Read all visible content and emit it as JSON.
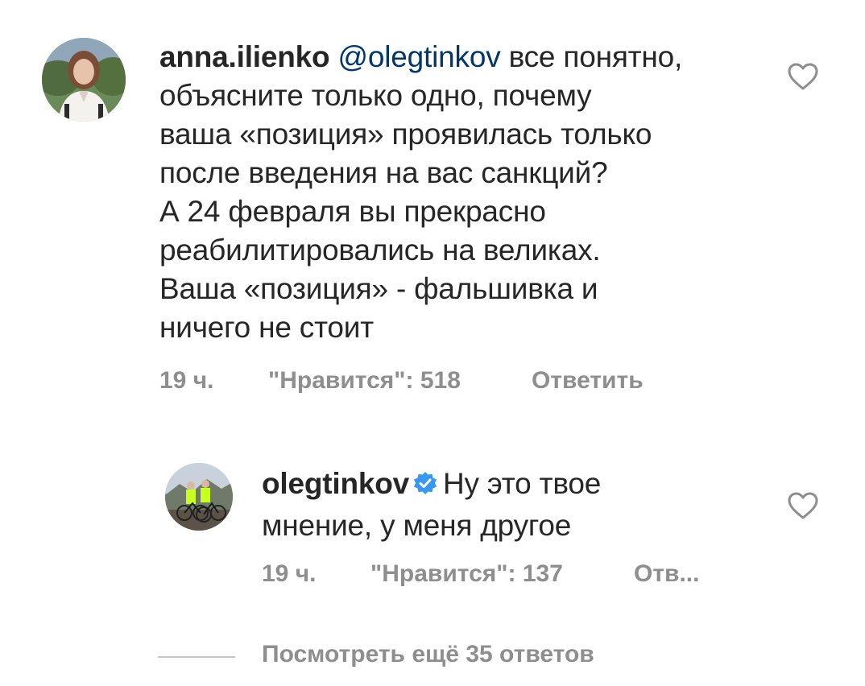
{
  "comment": {
    "username": "anna.ilienko",
    "mention": "@olegtinkov",
    "lines": [
      " все понятно,",
      "объясните только одно, почему",
      "ваша «позиция» проявилась только",
      "после введения на вас санкций?",
      "А 24 февраля вы прекрасно",
      "реабилитировались на великах.",
      "Ваша «позиция» - фальшивка и",
      "ничего не стоит"
    ],
    "time": "19 ч.",
    "likes": "\"Нравится\": 518",
    "reply": "Ответить",
    "like_icon": "heart-outline-icon"
  },
  "reply_comment": {
    "username": "olegtinkov",
    "verified_icon": "verified-badge-icon",
    "verified_color": "#3897f0",
    "lines": [
      "Ну это твое",
      "мнение, у меня другое"
    ],
    "time": "19 ч.",
    "likes": "\"Нравится\": 137",
    "reply": "Отв...",
    "like_icon": "heart-outline-icon"
  },
  "view_more": {
    "label": "Посмотреть ещё 35 ответов"
  }
}
